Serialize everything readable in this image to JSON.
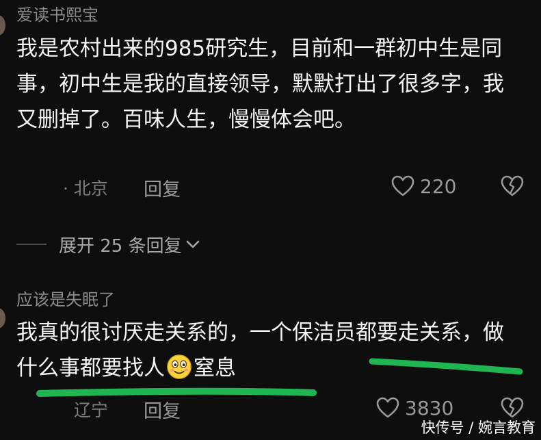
{
  "comments": [
    {
      "username": "爱读书熙宝",
      "text": "我是农村出来的985研究生，目前和一群初中生是同事，初中生是我的直接领导，默默打出了很多字，我又删掉了。百味人生，慢慢体会吧。",
      "location": "· 北京",
      "reply_label": "回复",
      "likes": "220"
    },
    {
      "username": "应该是失眠了",
      "text_part1": "我真的很讨厌走关系的，一个保洁员都要走关系，做什么事都要找人",
      "emoji": "smiling-face-emoji",
      "text_part2": "窒息",
      "location": "辽宁",
      "reply_label": "回复",
      "likes": "3830"
    }
  ],
  "expand_replies": {
    "label": "展开 25 条回复"
  },
  "highlight_color": "#1fb552",
  "watermark": "快传号 / 婉言教育",
  "icons": {
    "like": "heart-outline-icon",
    "dislike": "broken-heart-icon",
    "expand": "chevron-down-icon"
  }
}
